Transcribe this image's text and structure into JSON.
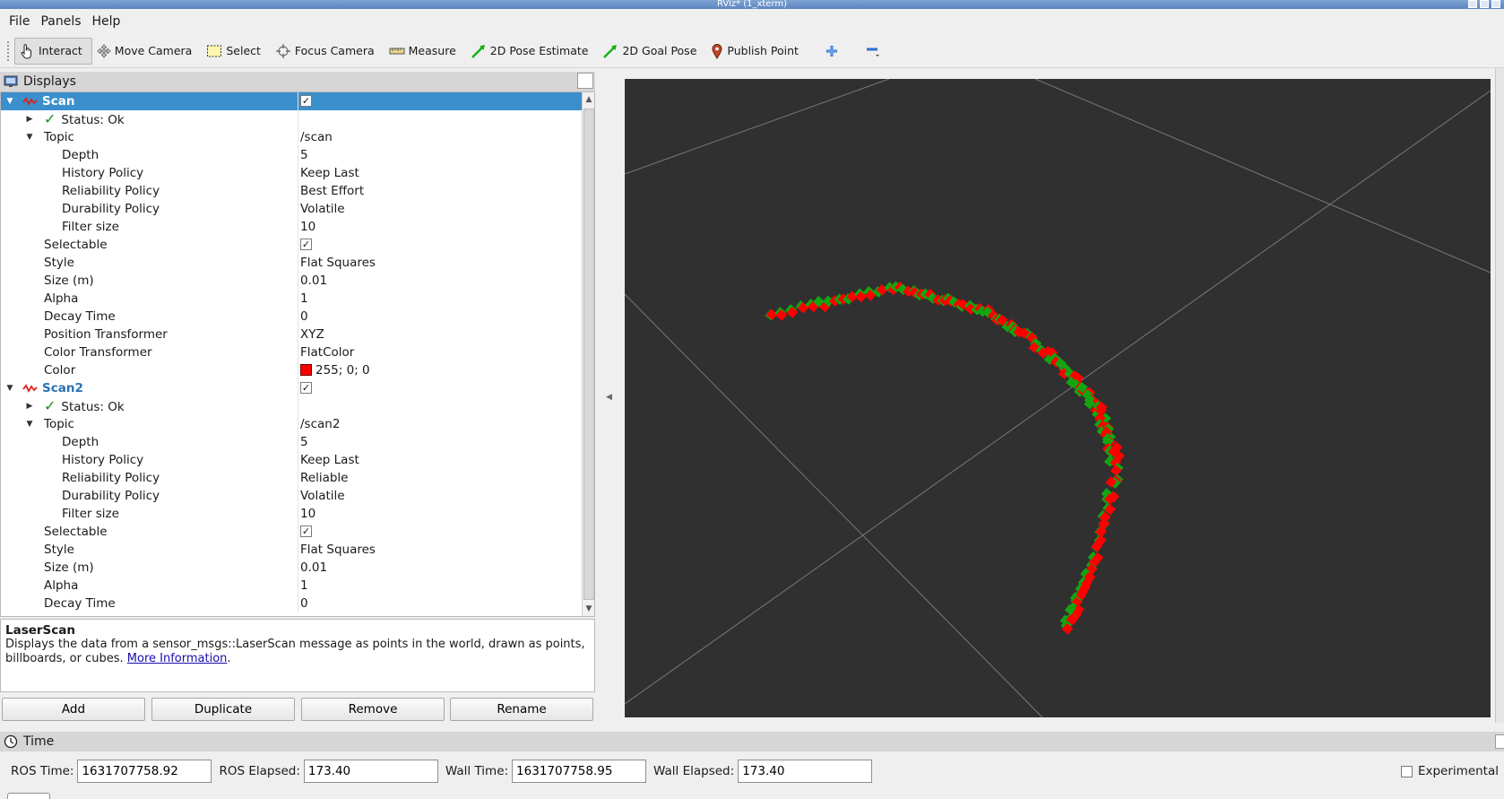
{
  "window": {
    "title": "RViz* (1_xterm)"
  },
  "menu": [
    "File",
    "Panels",
    "Help"
  ],
  "toolbar": {
    "tools": [
      {
        "name": "tool-interact",
        "label": "Interact",
        "icon": "hand-pointer-icon",
        "active": true
      },
      {
        "name": "tool-move-camera",
        "label": "Move Camera",
        "icon": "move-arrows-icon"
      },
      {
        "name": "tool-select",
        "label": "Select",
        "icon": "select-rectangle-icon"
      },
      {
        "name": "tool-focus-camera",
        "label": "Focus Camera",
        "icon": "focus-crosshair-icon"
      },
      {
        "name": "tool-measure",
        "label": "Measure",
        "icon": "ruler-icon"
      },
      {
        "name": "tool-2d-pose-estimate",
        "label": "2D Pose Estimate",
        "icon": "green-arrow-icon"
      },
      {
        "name": "tool-2d-goal-pose",
        "label": "2D Goal Pose",
        "icon": "green-arrow-icon"
      },
      {
        "name": "tool-publish-point",
        "label": "Publish Point",
        "icon": "map-pin-icon"
      }
    ],
    "add_tool_icon": "plus-icon",
    "remove_tool_icon": "minus-icon"
  },
  "displays_panel": {
    "title": "Displays",
    "rows": [
      {
        "label": "Scan",
        "value": "",
        "depth": 0,
        "expand": "open",
        "check": "checked",
        "icon": "laser-scan-icon",
        "selected": true
      },
      {
        "label": "Status: Ok",
        "value": "",
        "depth": 1,
        "expand": "closed",
        "status": true
      },
      {
        "label": "Topic",
        "value": "/scan",
        "depth": 1,
        "expand": "open"
      },
      {
        "label": "Depth",
        "value": "5",
        "depth": 2
      },
      {
        "label": "History Policy",
        "value": "Keep Last",
        "depth": 2
      },
      {
        "label": "Reliability Policy",
        "value": "Best Effort",
        "depth": 2
      },
      {
        "label": "Durability Policy",
        "value": "Volatile",
        "depth": 2
      },
      {
        "label": "Filter size",
        "value": "10",
        "depth": 2
      },
      {
        "label": "Selectable",
        "value": "",
        "depth": 1,
        "check": "checked"
      },
      {
        "label": "Style",
        "value": "Flat Squares",
        "depth": 1
      },
      {
        "label": "Size (m)",
        "value": "0.01",
        "depth": 1
      },
      {
        "label": "Alpha",
        "value": "1",
        "depth": 1
      },
      {
        "label": "Decay Time",
        "value": "0",
        "depth": 1
      },
      {
        "label": "Position Transformer",
        "value": "XYZ",
        "depth": 1
      },
      {
        "label": "Color Transformer",
        "value": "FlatColor",
        "depth": 1
      },
      {
        "label": "Color",
        "value": "255; 0; 0",
        "depth": 1,
        "swatch": "#ff0000"
      },
      {
        "label": "Scan2",
        "value": "",
        "depth": 0,
        "expand": "open",
        "check": "checked",
        "icon": "laser-scan-icon",
        "scan2": true
      },
      {
        "label": "Status: Ok",
        "value": "",
        "depth": 1,
        "expand": "closed",
        "status": true
      },
      {
        "label": "Topic",
        "value": "/scan2",
        "depth": 1,
        "expand": "open"
      },
      {
        "label": "Depth",
        "value": "5",
        "depth": 2
      },
      {
        "label": "History Policy",
        "value": "Keep Last",
        "depth": 2
      },
      {
        "label": "Reliability Policy",
        "value": "Reliable",
        "depth": 2
      },
      {
        "label": "Durability Policy",
        "value": "Volatile",
        "depth": 2
      },
      {
        "label": "Filter size",
        "value": "10",
        "depth": 2
      },
      {
        "label": "Selectable",
        "value": "",
        "depth": 1,
        "check": "checked"
      },
      {
        "label": "Style",
        "value": "Flat Squares",
        "depth": 1
      },
      {
        "label": "Size (m)",
        "value": "0.01",
        "depth": 1
      },
      {
        "label": "Alpha",
        "value": "1",
        "depth": 1
      },
      {
        "label": "Decay Time",
        "value": "0",
        "depth": 1
      }
    ]
  },
  "description": {
    "title": "LaserScan",
    "text": "Displays the data from a sensor_msgs::LaserScan message as points in the world, drawn as points, billboards, or cubes.",
    "link": "More Information",
    "trailing": "."
  },
  "buttons": {
    "add": "Add",
    "duplicate": "Duplicate",
    "remove": "Remove",
    "rename": "Rename"
  },
  "time_panel": {
    "title": "Time",
    "ros_time_label": "ROS Time:",
    "ros_time": "1631707758.92",
    "ros_elapsed_label": "ROS Elapsed:",
    "ros_elapsed": "173.40",
    "wall_time_label": "Wall Time:",
    "wall_time": "1631707758.95",
    "wall_elapsed_label": "Wall Elapsed:",
    "wall_elapsed": "173.40",
    "experimental_label": "Experimental"
  },
  "colors": {
    "scan1": "#ff0000",
    "scan2": "#11a611",
    "viewport_bg": "#303030",
    "selection": "#3b8fcc"
  }
}
